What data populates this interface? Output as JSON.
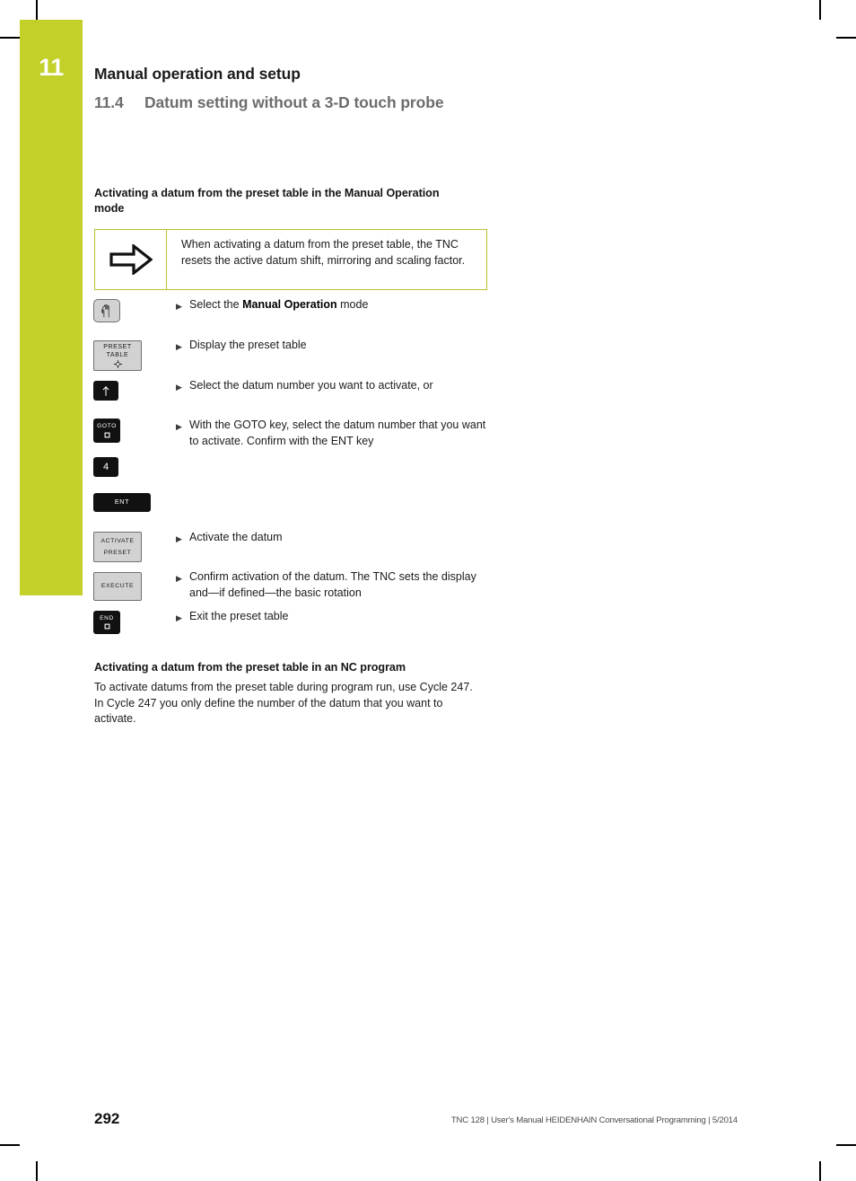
{
  "document": {
    "chapter_number": "11",
    "chapter_title": "Manual operation and setup",
    "section_number": "11.4",
    "section_title": "Datum setting without a 3-D touch probe",
    "page_number": "292",
    "footer": "TNC 128 | User's Manual HEIDENHAIN Conversational Programming | 5/2014",
    "accent_color": "#c3d02a",
    "note_border_color": "#b7c32c"
  },
  "sections": {
    "manual_mode": {
      "heading": "Activating a datum from the preset table in the Manual Operation mode",
      "note": {
        "icon": "arrow-right-outline-icon",
        "text": "When activating a datum from the preset table, the TNC resets the active datum shift, mirroring and scaling factor."
      }
    },
    "nc_program": {
      "heading": "Activating a datum from the preset table in an NC program",
      "paragraph": "To activate datums from the preset table during program run, use Cycle 247. In Cycle 247 you only define the number of the datum that you want to activate."
    }
  },
  "steps": [
    {
      "key_style": "light",
      "key_icon": "hand-icon",
      "key_label_1": "",
      "key_label_2": "",
      "text_html": "Select the <b>Manual Operation</b> mode",
      "text_plain": "Select the Manual Operation mode"
    },
    {
      "key_style": "light",
      "key_icon": "preset-datum-icon",
      "key_label_1": "PRESET",
      "key_label_2": "TABLE",
      "text_html": "Display the preset table",
      "text_plain": "Display the preset table"
    },
    {
      "key_style": "dark",
      "key_icon": "arrow-up-icon",
      "key_label_1": "",
      "key_label_2": "",
      "text_html": "Select the datum number you want to activate, or",
      "text_plain": "Select the datum number you want to activate, or"
    },
    {
      "key_style": "dark",
      "key_icon": "square-icon",
      "key_label_1": "GOTO",
      "key_label_2": "",
      "text_html": "With the GOTO key, select the datum number that you want to activate. Confirm with the ENT key",
      "text_plain": "With the GOTO key, select the datum number that you want to activate. Confirm with the ENT key"
    },
    {
      "key_style": "dark",
      "key_icon": "",
      "key_label_1": "4",
      "key_label_2": "",
      "text_html": "",
      "text_plain": ""
    },
    {
      "key_style": "dark",
      "key_icon": "",
      "key_label_1": "ENT",
      "key_label_2": "",
      "text_html": "",
      "text_plain": ""
    },
    {
      "key_style": "light",
      "key_icon": "",
      "key_label_1": "ACTIVATE",
      "key_label_2": "PRESET",
      "text_html": "Activate the datum",
      "text_plain": "Activate the datum"
    },
    {
      "key_style": "light",
      "key_icon": "",
      "key_label_1": "EXECUTE",
      "key_label_2": "",
      "text_html": "Confirm activation of the datum. The TNC sets the display and—if defined—the basic rotation",
      "text_plain": "Confirm activation of the datum. The TNC sets the display and—if defined—the basic rotation"
    },
    {
      "key_style": "dark",
      "key_icon": "square-icon",
      "key_label_1": "END",
      "key_label_2": "",
      "text_html": "Exit the preset table",
      "text_plain": "Exit the preset table"
    }
  ],
  "bullet_glyph": "▶"
}
